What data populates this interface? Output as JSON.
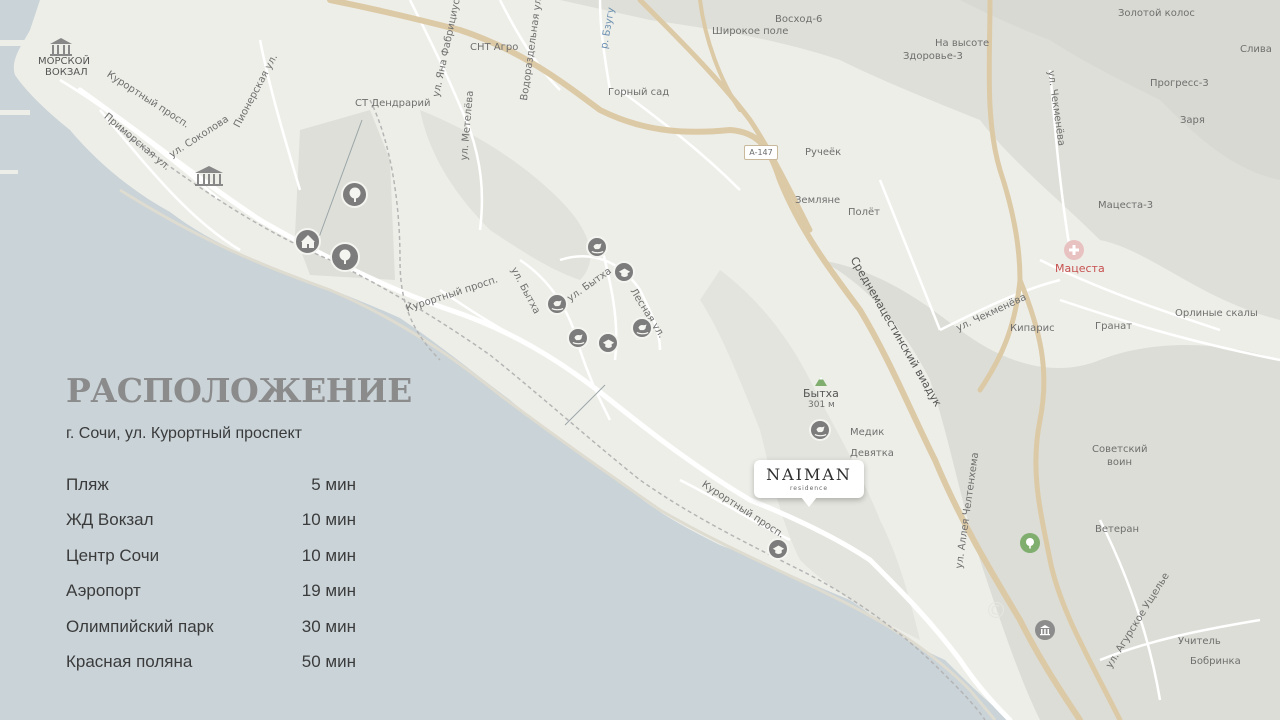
{
  "panel": {
    "title": "РАСПОЛОЖЕНИЕ",
    "address": "г. Сочи, ул. Курортный проспект",
    "times": [
      {
        "place": "Пляж",
        "time": "5 мин"
      },
      {
        "place": "ЖД Вокзал",
        "time": "10 мин"
      },
      {
        "place": "Центр Сочи",
        "time": "10 мин"
      },
      {
        "place": "Аэропорт",
        "time": "19 мин"
      },
      {
        "place": "Олимпийский парк",
        "time": "30 мин"
      },
      {
        "place": "Красная поляна",
        "time": "50 мин"
      }
    ]
  },
  "brand": {
    "name": "NAIMAN",
    "sub": "residence"
  },
  "road_shield": "A-147",
  "labels": {
    "morskoy": "МОРСКОЙ",
    "vokzal": "ВОКЗАЛ",
    "kurortny1": "Курортный просп.",
    "kurortny2": "Курортный просп.",
    "kurortny3": "Курортный просп.",
    "primorskaya": "Приморская ул.",
    "sokolova": "ул. Соколова",
    "pionerskaya": "Пионерская ул.",
    "fabriciusa": "ул. Яна Фабрициуса",
    "st_dendrariy": "СТ Дендрарий",
    "snt_agro": "СНТ Агро",
    "vodorazdelnaya": "Водораздельная ул.",
    "metelyova": "ул. Метелёва",
    "bzugu": "р. Бзугу",
    "gorny_sad": "Горный сад",
    "voskhod6": "Восход-6",
    "shirokoe_pole": "Широкое поле",
    "na_vysote": "На высоте",
    "zdorovye3": "Здоровье-3",
    "zolotoy_kolos": "Золотой колос",
    "sliva": "Слива",
    "progress3": "Прогресс-3",
    "zarya": "Заря",
    "chekmeneva1": "ул. Чекменёва",
    "chekmeneva2": "ул. Чекменёва",
    "ruchyok": "Ручеёк",
    "zemlyane": "Земляне",
    "polyot": "Полёт",
    "matsesta3": "Мацеста-3",
    "matsesta": "Мацеста",
    "viaduk": "Среднемацестинский виадук",
    "kiparis": "Кипарис",
    "granat": "Гранат",
    "orlinye_skaly": "Орлиные скалы",
    "bytkha_street1": "ул. Бытха",
    "bytkha_street2": "ул. Бытха",
    "lesnaya": "Лесная ул.",
    "bytkha": "Бытха",
    "bytkha_height": "301 м",
    "medik": "Медик",
    "devyatka": "Девятка",
    "chelteme": "ул. Аллея Челтенхема",
    "sovetsky": "Советский",
    "voin": "воин",
    "veteran": "Ветеран",
    "agurskoe": "ул. Агурское Ущелье",
    "uchitel": "Учитель",
    "bobrinka": "Бобринка"
  },
  "icons": {
    "park": "tree-icon",
    "circus": "circus-icon",
    "kindergarten": "rocking-horse-icon",
    "school": "graduation-cap-icon",
    "hospital": "medical-cross-icon",
    "museum": "museum-icon",
    "mountain": "mountain-peak-icon"
  },
  "colors": {
    "sea": "#c9d3d8",
    "land": "#eeeee9",
    "hills": "#dcdcd6",
    "road": "#dccaa6",
    "poi": "#7c7c7c",
    "text": "#3b3b3b",
    "title": "#8b8b8b",
    "hospital": "#d9534f",
    "park_green": "#7fae6e"
  }
}
